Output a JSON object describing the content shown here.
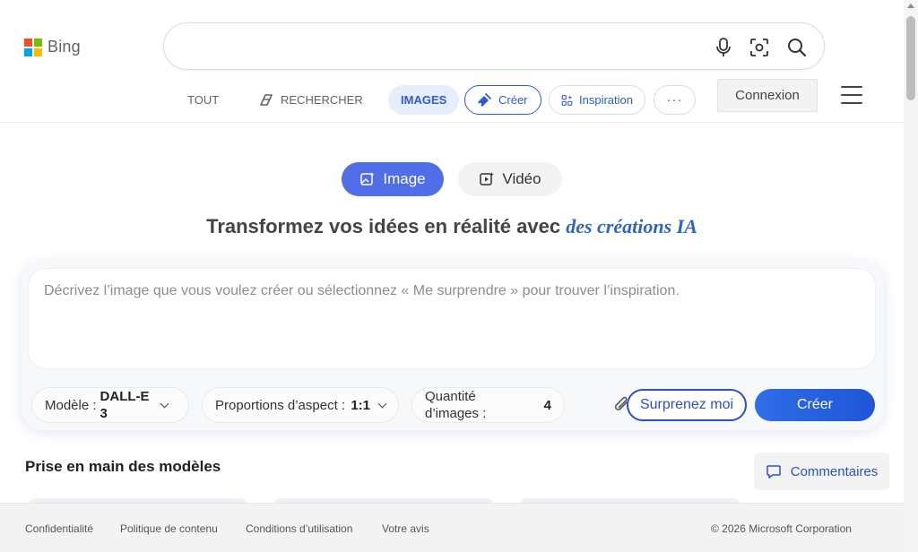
{
  "header": {
    "logo_text": "Bing",
    "logo_colors": [
      "#f25022",
      "#7fba00",
      "#00a4ef",
      "#ffb900"
    ],
    "search": {
      "value": "",
      "placeholder": ""
    },
    "icons": {
      "mic": "microphone-icon",
      "visual": "visual-search-icon",
      "search": "search-icon"
    },
    "connexion_label": "Connexion"
  },
  "nav": {
    "items": [
      {
        "label": "TOUT"
      },
      {
        "label": "RECHERCHER"
      },
      {
        "label": "IMAGES"
      },
      {
        "label": "Créer"
      },
      {
        "label": "Inspiration"
      },
      {
        "label": "···"
      }
    ],
    "active_index": 2
  },
  "mode": {
    "image_label": "Image",
    "video_label": "Vidéo",
    "active": "Image"
  },
  "headline": {
    "text": "Transformez vos idées en réalité avec",
    "accent": "des créations IA"
  },
  "creator": {
    "prompt_placeholder": "Décrivez l’image que vous voulez créer ou sélectionnez « Me surprendre » pour trouver l’inspiration.",
    "prompt_value": "",
    "model": {
      "label": "Modèle :",
      "value": "DALL-E 3"
    },
    "aspect": {
      "label": "Proportions d’aspect :",
      "value": "1:1"
    },
    "quantity": {
      "label": "Quantité d’images :",
      "value": "4"
    },
    "surprise_label": "Surprenez moi",
    "create_label": "Créer"
  },
  "section": {
    "title": "Prise en main des modèles"
  },
  "feedback_label": "Commentaires",
  "footer": {
    "links": [
      "Confidentialité",
      "Politique de contenu",
      "Conditions d’utilisation",
      "Votre avis"
    ],
    "copyright": "© 2026 Microsoft Corporation"
  },
  "colors": {
    "accent_blue": "#2e4fc9",
    "mode_active": "#4f6ee8",
    "nav_active_bg": "#e6edfb"
  }
}
